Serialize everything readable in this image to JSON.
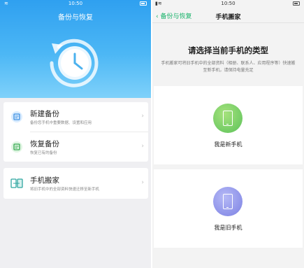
{
  "left": {
    "status_time": "10:50",
    "title": "备份与恢复",
    "items": [
      {
        "title": "新建备份",
        "subtitle": "备份您手机中重要数据、设置和应用",
        "icon": "new-backup-icon"
      },
      {
        "title": "恢复备份",
        "subtitle": "恢复已有的备份",
        "icon": "restore-backup-icon"
      },
      {
        "title": "手机搬家",
        "subtitle": "将旧手机中的全部资料快速迁移至新手机",
        "icon": "phone-migration-icon"
      }
    ]
  },
  "right": {
    "status_time": "10:50",
    "back_label": "备份与恢复",
    "title": "手机搬家",
    "heading": "请选择当前手机的类型",
    "description": "手机搬家可将旧手机中的全部资料（相册、联系人、应用程序等）快速搬至新手机，请保持电量充足",
    "options": [
      {
        "label": "我是新手机",
        "color": "#5cc25a"
      },
      {
        "label": "我是旧手机",
        "color": "#7c81e3"
      }
    ]
  },
  "colors": {
    "accent_green": "#19b36b",
    "hero_blue": "#2fa0f0"
  }
}
